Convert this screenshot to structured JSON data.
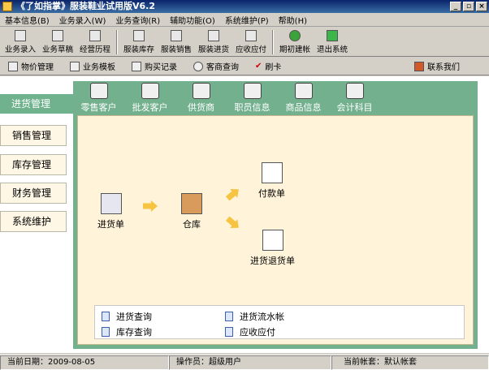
{
  "title": "《了如指掌》服装鞋业试用版V6.2",
  "window_buttons": [
    "_",
    "▫",
    "×"
  ],
  "menu": [
    "基本信息(B)",
    "业务录入(W)",
    "业务查询(R)",
    "辅助功能(O)",
    "系统维护(P)",
    "帮助(H)"
  ],
  "toolbar": [
    "业务录入",
    "业务草稿",
    "经营历程",
    "服装库存",
    "服装销售",
    "服装进货",
    "应收应付",
    "期初建帐",
    "退出系统"
  ],
  "toolbar2": [
    "物价管理",
    "业务模板",
    "购买记录",
    "客商查询",
    "刷卡",
    "联系我们"
  ],
  "left_nav": {
    "active": "进货管理",
    "items": [
      "销售管理",
      "库存管理",
      "财务管理",
      "系统维护"
    ]
  },
  "categories": [
    "零售客户",
    "批发客户",
    "供货商",
    "职员信息",
    "商品信息",
    "会计科目"
  ],
  "flow": {
    "purchase": "进货单",
    "warehouse": "仓库",
    "payment": "付款单",
    "return": "进货退货单"
  },
  "links": [
    "进货查询",
    "进货流水帐",
    "库存查询",
    "应收应付"
  ],
  "status": {
    "date": "当前日期：2009-08-05",
    "operator": "操作员：超级用户",
    "account": "当前帐套：默认帐套"
  }
}
